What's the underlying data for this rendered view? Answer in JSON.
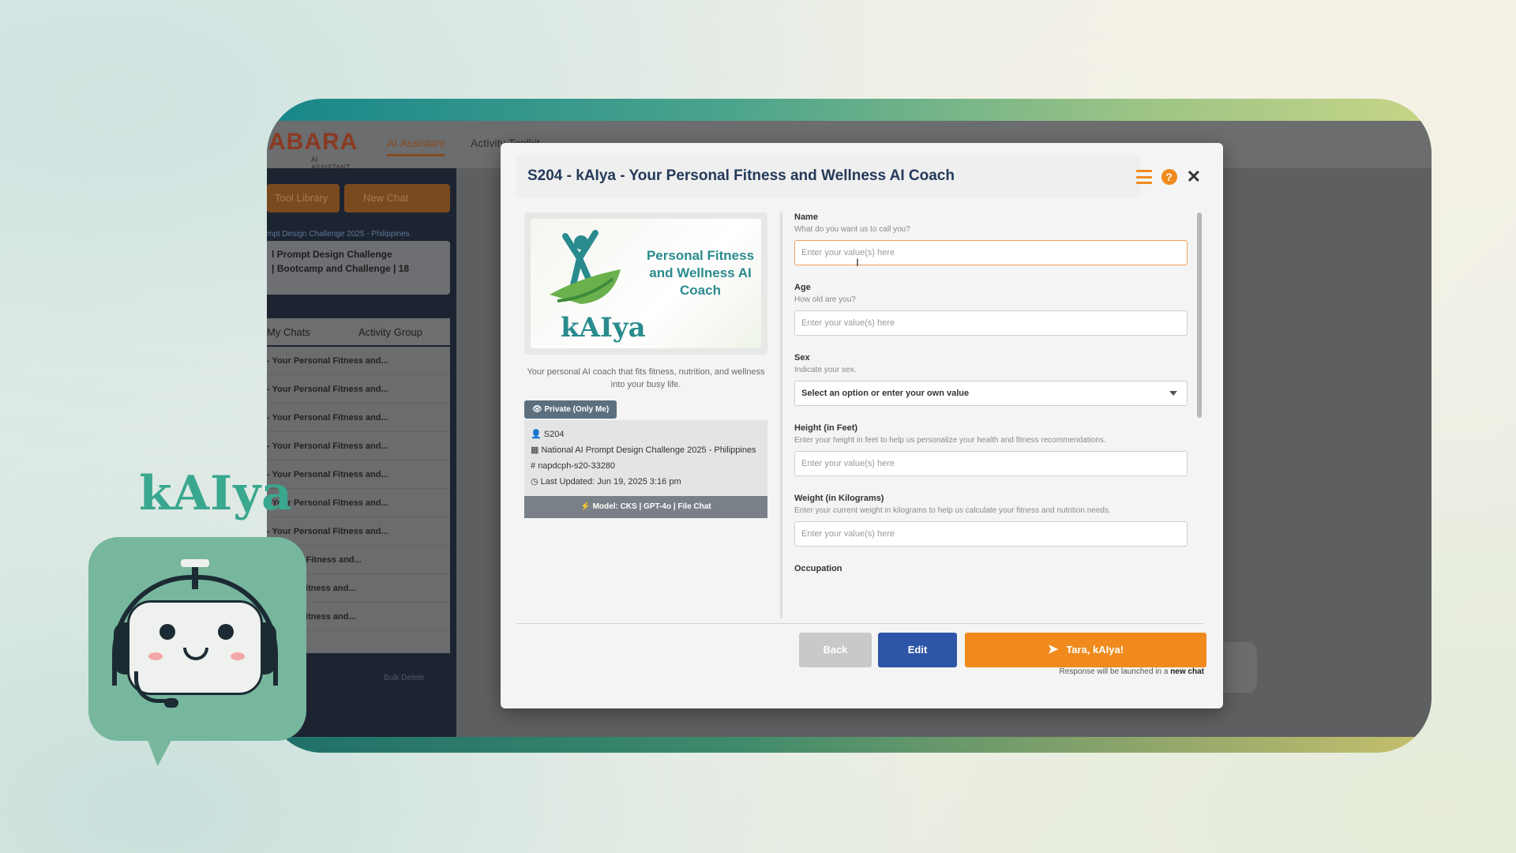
{
  "app": {
    "logo": "ABARA",
    "logo_sub": "AI ASSISTANT",
    "nav": [
      "AI Assistant",
      "Activity Toolkit"
    ]
  },
  "sidebar": {
    "tool_library": "Tool Library",
    "new_chat": "New Chat",
    "section_title": "mpt Design Challenge 2025 - Philippines",
    "card_line1": "l Prompt Design Challenge",
    "card_line2": "| Bootcamp and Challenge | 18",
    "tabs": [
      "My Chats",
      "Activity Group"
    ],
    "items": [
      "- Your Personal Fitness and...",
      "- Your Personal Fitness and...",
      "- Your Personal Fitness and...",
      "- Your Personal Fitness and...",
      "- Your Personal Fitness and...",
      "- Your Personal Fitness and...",
      "- Your Personal Fitness and...",
      "Personal Fitness and...",
      "ersonal Fitness and...",
      "ersonal Fitness and..."
    ],
    "bulk_delete": "Bulk Delete"
  },
  "modal": {
    "title": "S204 - kAIya - Your Personal Fitness and Wellness AI Coach",
    "hero_text": "Personal Fitness and Wellness AI Coach",
    "hero_brand": "kAIya",
    "description": "Your personal AI coach that fits fitness, nutrition, and wellness into your busy life.",
    "private_label": "Private (Only Me)",
    "info": {
      "code": "S204",
      "org": "National AI Prompt Design Challenge 2025 - Philippines",
      "tag": "napdcph-s20-33280",
      "updated_label": "Last Updated:",
      "updated_value": "Jun 19, 2025 3:16 pm"
    },
    "model": "Model: CKS | GPT-4o | File Chat",
    "fields": [
      {
        "label": "Name",
        "help": "What do you want us to call you?",
        "placeholder": "Enter your value(s) here"
      },
      {
        "label": "Age",
        "help": "How old are you?",
        "placeholder": "Enter your value(s) here"
      },
      {
        "label": "Sex",
        "help": "Indicate your sex.",
        "placeholder": "Select an option or enter your own value"
      },
      {
        "label": "Height (in Feet)",
        "help": "Enter your height in feet to help us personalize your health and fitness recommendations.",
        "placeholder": "Enter your value(s) here"
      },
      {
        "label": "Weight (in Kilograms)",
        "help": "Enter your current weight in kilograms to help us calculate your fitness and nutrition needs.",
        "placeholder": "Enter your value(s) here"
      },
      {
        "label": "Occupation"
      }
    ],
    "buttons": {
      "back": "Back",
      "edit": "Edit",
      "submit": "Tara, kAIya!"
    },
    "note_prefix": "Response will be launched in a",
    "note_bold": "new chat"
  },
  "mascot": {
    "wordmark": "kAIya"
  },
  "colors": {
    "accent": "#f08a1c",
    "edit": "#2f55a8",
    "title": "#243a5a",
    "brand": "#2a8b8e"
  }
}
